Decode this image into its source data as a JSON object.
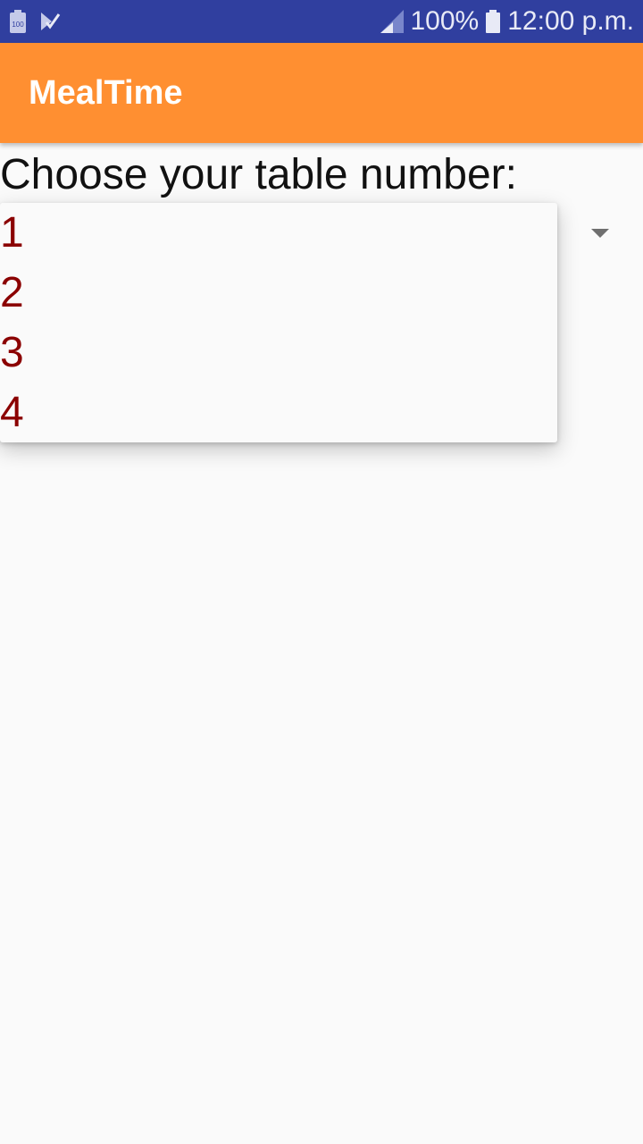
{
  "status_bar": {
    "left_icons": [
      "battery-100-notification-icon",
      "task-check-notification-icon"
    ],
    "battery_small_label": "100",
    "battery_percent": "100%",
    "time": "12:00 p.m.",
    "colors": {
      "background": "#303f9f",
      "foreground": "#e8eaf6"
    }
  },
  "app_bar": {
    "title": "MealTime",
    "color": "#ff8f31"
  },
  "main": {
    "prompt": "Choose your table number:",
    "spinner": {
      "options": [
        "1",
        "2",
        "3",
        "4"
      ],
      "option_color": "#8b0000"
    }
  }
}
